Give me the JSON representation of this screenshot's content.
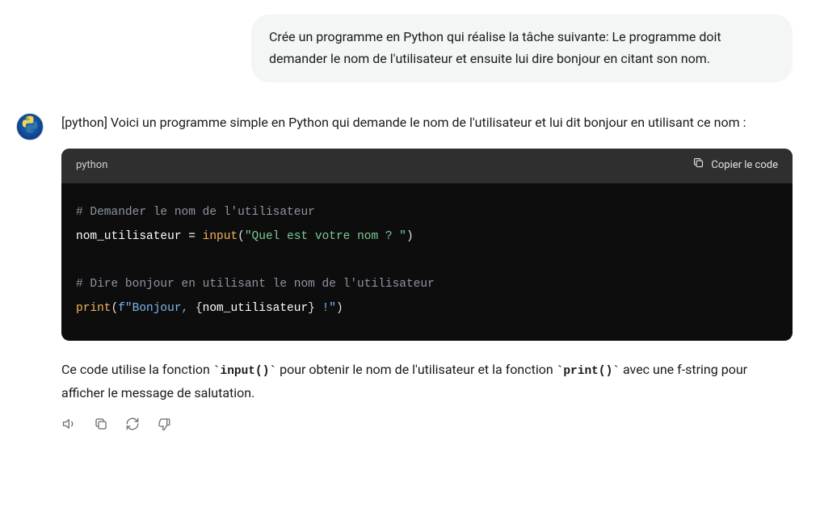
{
  "user": {
    "message": "Crée un programme en Python qui réalise la tâche suivante: Le programme doit demander le nom de l'utilisateur et ensuite lui dire bonjour en citant son nom."
  },
  "assistant": {
    "intro": "[python] Voici un programme simple en Python qui demande le nom de l'utilisateur et lui dit bonjour en utilisant ce nom :",
    "outro_pre": "Ce code utilise la fonction ",
    "outro_code1": "`input()`",
    "outro_mid": " pour obtenir le nom de l'utilisateur et la fonction ",
    "outro_code2": "`print()`",
    "outro_post": " avec une f-string pour afficher le message de salutation."
  },
  "code": {
    "lang_label": "python",
    "copy_label": "Copier le code",
    "line1_comment": "# Demander le nom de l'utilisateur",
    "line2_var": "nom_utilisateur",
    "line2_eq": " = ",
    "line2_func": "input",
    "line2_open": "(",
    "line2_str": "\"Quel est votre nom ? \"",
    "line2_close": ")",
    "line4_comment": "# Dire bonjour en utilisant le nom de l'utilisateur",
    "line5_func": "print",
    "line5_open": "(",
    "line5_f": "f\"Bonjour, ",
    "line5_brace_open": "{",
    "line5_var": "nom_utilisateur",
    "line5_brace_close": "}",
    "line5_f_end": " !\"",
    "line5_close": ")"
  },
  "actions": {
    "speaker": "speaker-icon",
    "copy": "copy-icon",
    "regen": "regenerate-icon",
    "dislike": "thumbs-down-icon"
  }
}
